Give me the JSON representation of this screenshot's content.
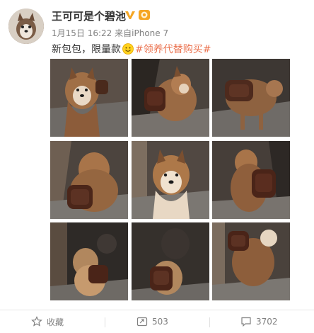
{
  "user": {
    "name": "王可可是个碧池",
    "avatar_icon": "dog-avatar",
    "verified_icon": "verified-v-icon",
    "medal_icon": "medal-icon"
  },
  "post": {
    "date": "1月15日 16:22",
    "source_prefix": "来自",
    "source": "iPhone 7",
    "text": "新包包，限量款",
    "emoji": "smiley-emoji",
    "topic": "#领养代替购买#"
  },
  "photos": [
    {
      "alt": "husky-with-backpack-1"
    },
    {
      "alt": "husky-with-backpack-2"
    },
    {
      "alt": "husky-with-backpack-3"
    },
    {
      "alt": "husky-with-backpack-4"
    },
    {
      "alt": "husky-with-backpack-5"
    },
    {
      "alt": "husky-with-backpack-6"
    },
    {
      "alt": "husky-with-backpack-7"
    },
    {
      "alt": "husky-with-backpack-8"
    },
    {
      "alt": "husky-with-backpack-9"
    }
  ],
  "actions": {
    "favorite_label": "收藏",
    "repost_count": "503",
    "comment_count": "3702"
  },
  "colors": {
    "accent": "#eb7350",
    "badge": "#f5a623",
    "text_muted": "#808080"
  }
}
